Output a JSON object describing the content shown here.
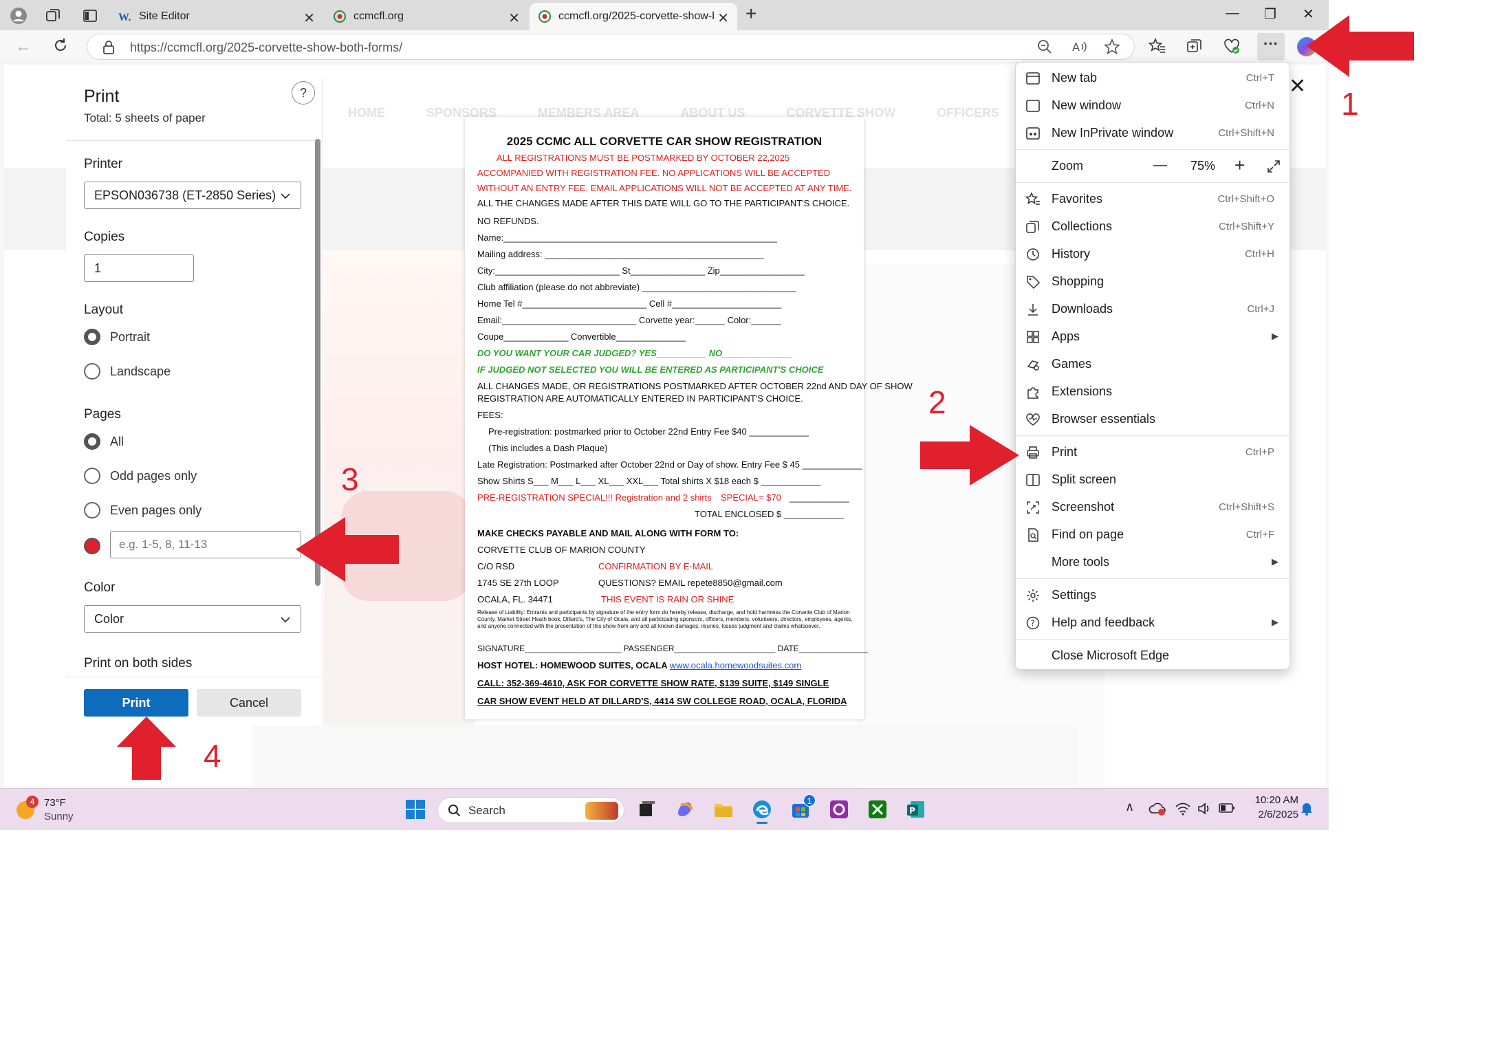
{
  "browser": {
    "tabs": [
      {
        "label": "Site Editor",
        "favicon": "wordpress-icon"
      },
      {
        "label": "ccmcfl.org",
        "favicon": "ccmc-logo-icon"
      },
      {
        "label": "ccmcfl.org/2025-corvette-show-b",
        "favicon": "ccmc-logo-icon"
      }
    ],
    "url": "https://ccmcfl.org/2025-corvette-show-both-forms/"
  },
  "background_page": {
    "nav": [
      "HOME",
      "SPONSORS",
      "MEMBERS AREA",
      "ABOUT US",
      "CORVETTE SHOW",
      "OFFICERS"
    ]
  },
  "print_dialog": {
    "title": "Print",
    "total": "Total: 5 sheets of paper",
    "help": "?",
    "printer_label": "Printer",
    "printer_value": "EPSON036738 (ET-2850 Series)",
    "copies_label": "Copies",
    "copies_value": "1",
    "layout_label": "Layout",
    "layout_options": [
      "Portrait",
      "Landscape"
    ],
    "layout_selected": "Portrait",
    "pages_label": "Pages",
    "pages_options": [
      "All",
      "Odd pages only",
      "Even pages only"
    ],
    "pages_custom_placeholder": "e.g. 1-5, 8, 11-13",
    "color_label": "Color",
    "color_value": "Color",
    "both_sides_label": "Print on both sides",
    "print_button": "Print",
    "cancel_button": "Cancel"
  },
  "preview": {
    "title": "2025 CCMC ALL CORVETTE CAR SHOW REGISTRATION",
    "lines": {
      "l1": "ALL REGISTRATIONS MUST BE POSTMARKED BY OCTOBER 22,2025",
      "l2": "ACCOMPANIED WITH REGISTRATION FEE. NO APPLICATIONS WILL BE ACCEPTED",
      "l3": "WITHOUT AN ENTRY FEE. EMAIL APPLICATIONS WILL NOT BE ACCEPTED AT ANY TIME.",
      "l4": "ALL THE CHANGES MADE AFTER THIS DATE WILL GO TO THE PARTICIPANT'S CHOICE.",
      "l5": "NO REFUNDS.",
      "name": "Name:_______________________________________________________",
      "mailing": "Mailing address: ____________________________________________",
      "city": "City:_________________________ St_______________ Zip_________________",
      "club": "Club affiliation (please do not abbreviate) _______________________________",
      "tel": "Home Tel #_________________________ Cell #______________________",
      "email": "Email:___________________________ Corvette year:______ Color:______",
      "coupe": "Coupe_____________ Convertible______________",
      "judged": "DO YOU WANT YOUR CAR JUDGED? YES__________ NO______________",
      "notsel": "IF JUDGED NOT SELECTED YOU WILL BE ENTERED AS PARTICIPANT'S CHOICE",
      "changes1": "ALL CHANGES MADE, OR REGISTRATIONS POSTMARKED AFTER OCTOBER 22nd AND DAY OF SHOW",
      "changes2": "REGISTRATION ARE AUTOMATICALLY ENTERED IN PARTICIPANT'S CHOICE.",
      "fees": "FEES:",
      "prereg": "Pre-registration: postmarked prior to October 22nd        Entry Fee $40        ____________",
      "dash": "(This includes a Dash Plaque)",
      "late": "Late Registration: Postmarked after October 22nd or Day of show.   Entry Fee $ 45 ____________",
      "shirts": "Show Shirts S___ M___ L___ XL___ XXL___          Total shirts X $18 each $    ____________",
      "special": "PRE-REGISTRATION SPECIAL!!! Registration and 2 shirts",
      "special_price": "SPECIAL= $70",
      "special_blank": "____________",
      "total": "TOTAL ENCLOSED      $ ____________",
      "checks": "MAKE CHECKS PAYABLE AND MAIL ALONG WITH FORM TO:",
      "club_name": "CORVETTE CLUB OF MARION COUNTY",
      "co": "C/O RSD",
      "confirm": "CONFIRMATION BY E-MAIL",
      "addr": "1745 SE 27th LOOP",
      "questions": "QUESTIONS?  EMAIL repete8850@gmail.com",
      "ocala": "OCALA, FL. 34471",
      "rain": "THIS EVENT IS RAIN OR SHINE",
      "release": "Release of Liability: Entrants and participants by signature of the entry form do hereby release, discharge, and hold harmless the Corvette Club of Marion County, Market Street Heath book, Dillard's, The City of Ocala, and all participating sponsors, officers, members, volunteers, directors, employees, agents, and anyone connected with the presentation of this show from any and all known damages, injuries, losses judgment and claims whatsoever.",
      "signature": "SIGNATURE_____________________ PASSENGER______________________ DATE_______________",
      "hotel_label": "HOST HOTEL: HOMEWOOD SUITES, OCALA",
      "hotel_link": "www.ocala.homewoodsuites.com",
      "call": "CALL: 352-369-4610, ASK FOR CORVETTE SHOW RATE, $139 SUITE, $149 SINGLE",
      "event": "CAR SHOW EVENT HELD AT DILLARD'S, 4414 SW COLLEGE ROAD, OCALA, FLORIDA"
    }
  },
  "edge_menu": {
    "items": [
      {
        "label": "New tab",
        "shortcut": "Ctrl+T",
        "icon": "new-tab-icon"
      },
      {
        "label": "New window",
        "shortcut": "Ctrl+N",
        "icon": "new-window-icon"
      },
      {
        "label": "New InPrivate window",
        "shortcut": "Ctrl+Shift+N",
        "icon": "inprivate-icon"
      },
      {
        "label": "Zoom",
        "shortcut": "",
        "icon": ""
      },
      {
        "label": "Favorites",
        "shortcut": "Ctrl+Shift+O",
        "icon": "favorites-icon"
      },
      {
        "label": "Collections",
        "shortcut": "Ctrl+Shift+Y",
        "icon": "collections-icon"
      },
      {
        "label": "History",
        "shortcut": "Ctrl+H",
        "icon": "history-icon"
      },
      {
        "label": "Shopping",
        "shortcut": "",
        "icon": "shopping-tag-icon"
      },
      {
        "label": "Downloads",
        "shortcut": "Ctrl+J",
        "icon": "download-icon"
      },
      {
        "label": "Apps",
        "shortcut": "",
        "icon": "apps-icon"
      },
      {
        "label": "Games",
        "shortcut": "",
        "icon": "games-icon"
      },
      {
        "label": "Extensions",
        "shortcut": "",
        "icon": "puzzle-icon"
      },
      {
        "label": "Browser essentials",
        "shortcut": "",
        "icon": "heart-pulse-icon"
      },
      {
        "label": "Print",
        "shortcut": "Ctrl+P",
        "icon": "printer-icon"
      },
      {
        "label": "Split screen",
        "shortcut": "",
        "icon": "split-screen-icon"
      },
      {
        "label": "Screenshot",
        "shortcut": "Ctrl+Shift+S",
        "icon": "screenshot-icon"
      },
      {
        "label": "Find on page",
        "shortcut": "Ctrl+F",
        "icon": "find-icon"
      },
      {
        "label": "More tools",
        "shortcut": "",
        "icon": ""
      },
      {
        "label": "Settings",
        "shortcut": "",
        "icon": "gear-icon"
      },
      {
        "label": "Help and feedback",
        "shortcut": "",
        "icon": "help-icon"
      },
      {
        "label": "Close Microsoft Edge",
        "shortcut": "",
        "icon": ""
      }
    ],
    "zoom_value": "75%",
    "zoom_minus": "—",
    "zoom_plus": "+"
  },
  "taskbar": {
    "weather_temp": "73°F",
    "weather_desc": "Sunny",
    "weather_badge": "4",
    "search_placeholder": "Search",
    "time": "10:20 AM",
    "date": "2/6/2025",
    "store_badge": "1"
  },
  "annotations": {
    "n1": "1",
    "n2": "2",
    "n3": "3",
    "n4": "4",
    "color": "#e0202c"
  }
}
